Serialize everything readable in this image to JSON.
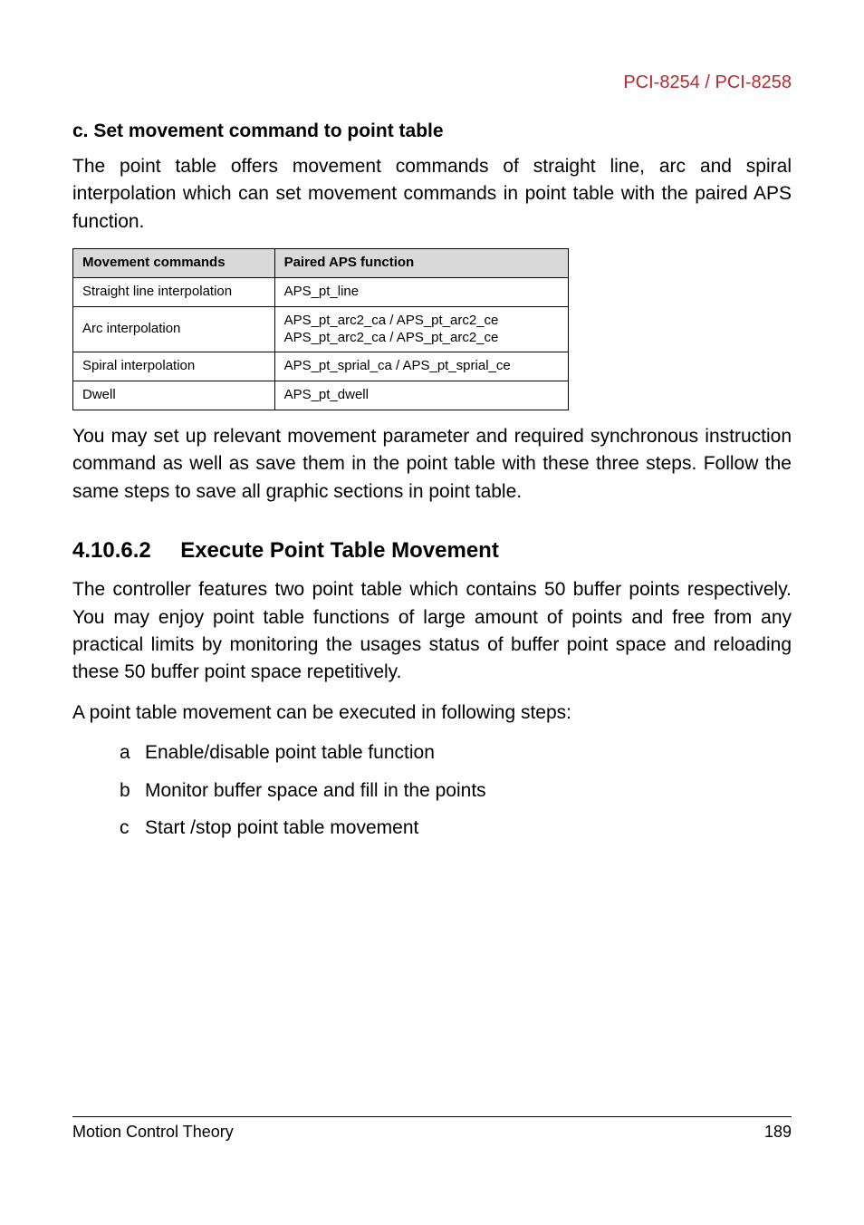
{
  "header": {
    "product": "PCI-8254 / PCI-8258"
  },
  "sectionC": {
    "title": "c. Set movement command to point table",
    "para": "The point table offers movement commands of straight line, arc and spiral interpolation which can set movement commands in point table with the paired APS function."
  },
  "table": {
    "head": {
      "c1": "Movement commands",
      "c2": "Paired APS function"
    },
    "rows": [
      {
        "c1": "Straight line interpolation",
        "c2": "APS_pt_line"
      },
      {
        "c1": "Arc interpolation",
        "c2": "APS_pt_arc2_ca / APS_pt_arc2_ce\nAPS_pt_arc2_ca / APS_pt_arc2_ce"
      },
      {
        "c1": "Spiral interpolation",
        "c2": "APS_pt_sprial_ca / APS_pt_sprial_ce"
      },
      {
        "c1": "Dwell",
        "c2": "APS_pt_dwell"
      }
    ]
  },
  "afterTablePara": "You may set up relevant movement parameter and required synchronous instruction command as well as save them in the point table with these three steps. Follow the same steps to save all graphic sections in point table.",
  "subsection": {
    "num": "4.10.6.2",
    "title": "Execute Point Table Movement",
    "para1": "The controller features two point table which contains 50 buffer points respectively. You may enjoy point table functions of large amount of points and free from any practical limits by monitoring the usages status of buffer point space and reloading these 50 buffer point space repetitively.",
    "para2": "A point table movement can be executed in following steps:",
    "steps": [
      {
        "m": "a",
        "t": "Enable/disable point table function"
      },
      {
        "m": "b",
        "t": "Monitor buffer space and fill in the points"
      },
      {
        "m": "c",
        "t": "Start /stop point table movement"
      }
    ]
  },
  "footer": {
    "left": "Motion Control Theory",
    "right": "189"
  }
}
